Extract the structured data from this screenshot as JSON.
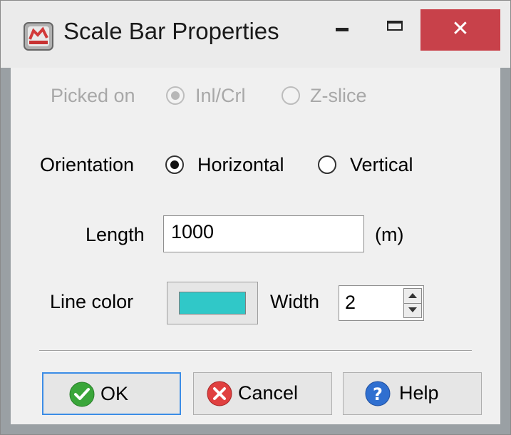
{
  "window": {
    "title": "Scale Bar Properties",
    "close_glyph": "✕",
    "title_icon": "scale-bar-app-icon"
  },
  "picked_on": {
    "label": "Picked on",
    "options": [
      "Inl/Crl",
      "Z-slice"
    ],
    "selected": "Inl/Crl",
    "enabled": false
  },
  "orientation": {
    "label": "Orientation",
    "options": [
      "Horizontal",
      "Vertical"
    ],
    "selected": "Horizontal"
  },
  "length": {
    "label": "Length",
    "value": "1000",
    "unit": "(m)"
  },
  "line_color": {
    "label": "Line color",
    "color": "#30c8c8"
  },
  "width": {
    "label": "Width",
    "value": "2"
  },
  "buttons": {
    "ok": "OK",
    "cancel": "Cancel",
    "help": "Help"
  },
  "colors": {
    "close_button": "#c8414a",
    "default_button_border": "#3c8de6",
    "ok_icon": "#3aa63a",
    "cancel_icon": "#e04040",
    "help_icon": "#2f6fd0"
  }
}
